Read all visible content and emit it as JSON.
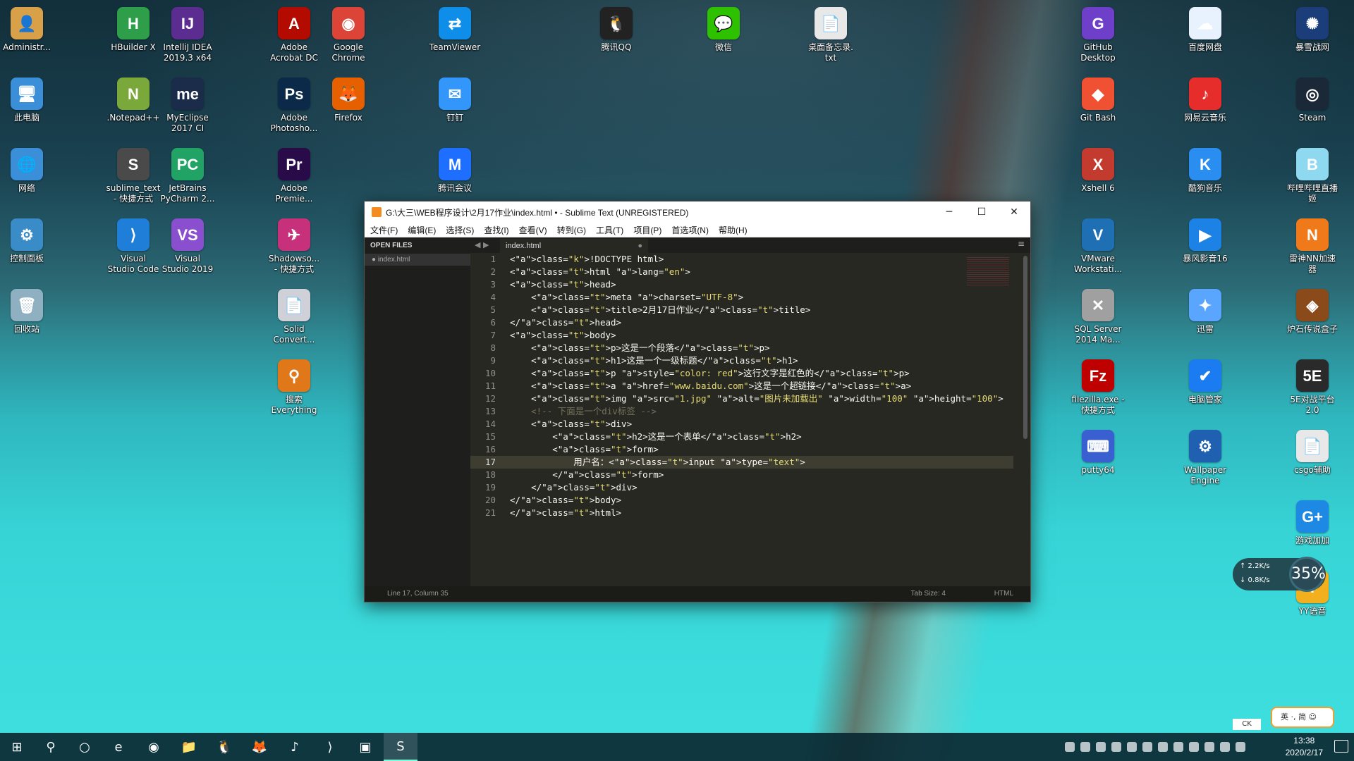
{
  "desktop_icons": [
    {
      "label": "Administr...",
      "icon": "user-folder-icon",
      "color": "#d9a04a",
      "glyph": "👤"
    },
    {
      "label": "此电脑",
      "icon": "computer-icon",
      "color": "#3b8fd8",
      "glyph": "🖥"
    },
    {
      "label": "网络",
      "icon": "network-icon",
      "color": "#3b8fd8",
      "glyph": "🌐"
    },
    {
      "label": "控制面板",
      "icon": "control-panel-icon",
      "color": "#3a8cc8",
      "glyph": "⚙"
    },
    {
      "label": "回收站",
      "icon": "recycle-bin-icon",
      "color": "#8fb0c0",
      "glyph": "🗑"
    },
    {
      "label": "HBuilder X",
      "icon": "hbuilder-icon",
      "color": "#2e9e4b",
      "glyph": "H"
    },
    {
      "label": ".Notepad++",
      "icon": "notepad-plus-plus-icon",
      "color": "#7aa83a",
      "glyph": "N"
    },
    {
      "label": "sublime_text\n- 快捷方式",
      "icon": "sublime-text-icon",
      "color": "#4a4a4a",
      "glyph": "S"
    },
    {
      "label": "Visual\nStudio Code",
      "icon": "vscode-icon",
      "color": "#1f7fd8",
      "glyph": "⟩"
    },
    {
      "label": "IntelliJ IDEA\n2019.3 x64",
      "icon": "intellij-icon",
      "color": "#5c2d91",
      "glyph": "IJ"
    },
    {
      "label": "MyEclipse\n2017 CI",
      "icon": "myeclipse-icon",
      "color": "#1a2c4a",
      "glyph": "me"
    },
    {
      "label": "JetBrains\nPyCharm 2...",
      "icon": "pycharm-icon",
      "color": "#21a366",
      "glyph": "PC"
    },
    {
      "label": "Visual\nStudio 2019",
      "icon": "visual-studio-icon",
      "color": "#8a4fcf",
      "glyph": "VS"
    },
    {
      "label": "Adobe\nAcrobat DC",
      "icon": "acrobat-icon",
      "color": "#b30b00",
      "glyph": "A"
    },
    {
      "label": "Adobe\nPhotosho...",
      "icon": "photoshop-icon",
      "color": "#0b2a4a",
      "glyph": "Ps"
    },
    {
      "label": "Adobe\nPremie...",
      "icon": "premiere-icon",
      "color": "#2a0b4a",
      "glyph": "Pr"
    },
    {
      "label": "Shadowso...\n- 快捷方式",
      "icon": "shadowsocks-icon",
      "color": "#c7307a",
      "glyph": "✈"
    },
    {
      "label": "Solid\nConvert...",
      "icon": "solid-converter-icon",
      "color": "#d0d0d8",
      "glyph": "📄"
    },
    {
      "label": "搜索\nEverything",
      "icon": "everything-search-icon",
      "color": "#e0781a",
      "glyph": "⚲"
    },
    {
      "label": "Google\nChrome",
      "icon": "chrome-icon",
      "color": "#db4437",
      "glyph": "◉"
    },
    {
      "label": "Firefox",
      "icon": "firefox-icon",
      "color": "#e66000",
      "glyph": "🦊"
    },
    {
      "label": "TeamViewer",
      "icon": "teamviewer-icon",
      "color": "#0e8ee9",
      "glyph": "⇄"
    },
    {
      "label": "钉钉",
      "icon": "dingtalk-icon",
      "color": "#3296fa",
      "glyph": "✉"
    },
    {
      "label": "腾讯会议",
      "icon": "tencent-meeting-icon",
      "color": "#1e6fff",
      "glyph": "M"
    },
    {
      "label": "腾讯QQ",
      "icon": "qq-icon",
      "color": "#222222",
      "glyph": "🐧"
    },
    {
      "label": "微信",
      "icon": "wechat-icon",
      "color": "#2dc100",
      "glyph": "💬"
    },
    {
      "label": "桌面备忘录.\ntxt",
      "icon": "text-file-icon",
      "color": "#e8e8e8",
      "glyph": "📄"
    },
    {
      "label": "GitHub\nDesktop",
      "icon": "github-desktop-icon",
      "color": "#6e40c9",
      "glyph": "G"
    },
    {
      "label": "Git Bash",
      "icon": "git-bash-icon",
      "color": "#f05133",
      "glyph": "◆"
    },
    {
      "label": "Xshell 6",
      "icon": "xshell-icon",
      "color": "#c33b2f",
      "glyph": "X"
    },
    {
      "label": "VMware\nWorkstati...",
      "icon": "vmware-icon",
      "color": "#1f6fb4",
      "glyph": "V"
    },
    {
      "label": "SQL Server\n2014 Ma...",
      "icon": "sql-server-icon",
      "color": "#a0a0a0",
      "glyph": "✕"
    },
    {
      "label": "filezilla.exe -\n快捷方式",
      "icon": "filezilla-icon",
      "color": "#bf0000",
      "glyph": "Fz"
    },
    {
      "label": "putty64",
      "icon": "putty-icon",
      "color": "#3a5fd0",
      "glyph": "⌨"
    },
    {
      "label": "百度网盘",
      "icon": "baidu-netdisk-icon",
      "color": "#e8f2ff",
      "glyph": "☁"
    },
    {
      "label": "网易云音乐",
      "icon": "netease-music-icon",
      "color": "#e72d2c",
      "glyph": "♪"
    },
    {
      "label": "酷狗音乐",
      "icon": "kugou-music-icon",
      "color": "#2a8ef0",
      "glyph": "K"
    },
    {
      "label": "暴风影音16",
      "icon": "baofeng-player-icon",
      "color": "#1d82e6",
      "glyph": "▶"
    },
    {
      "label": "迅雷",
      "icon": "xunlei-icon",
      "color": "#5aa6ff",
      "glyph": "✦"
    },
    {
      "label": "电脑管家",
      "icon": "pc-manager-icon",
      "color": "#1a7cf0",
      "glyph": "✔"
    },
    {
      "label": "Wallpaper\nEngine",
      "icon": "wallpaper-engine-icon",
      "color": "#2060b0",
      "glyph": "⚙"
    },
    {
      "label": "暴雪战网",
      "icon": "battlenet-icon",
      "color": "#1b3e7a",
      "glyph": "✺"
    },
    {
      "label": "Steam",
      "icon": "steam-icon",
      "color": "#1b2838",
      "glyph": "◎"
    },
    {
      "label": "哔哩哔哩直播\n姬",
      "icon": "bilibili-live-icon",
      "color": "#8ed8f0",
      "glyph": "B"
    },
    {
      "label": "雷神NN加速\n器",
      "icon": "nn-accelerator-icon",
      "color": "#f07a1a",
      "glyph": "N"
    },
    {
      "label": "炉石传说盒子",
      "icon": "hearthstone-box-icon",
      "color": "#8a4a1a",
      "glyph": "◈"
    },
    {
      "label": "5E对战平台\n2.0",
      "icon": "5e-platform-icon",
      "color": "#2a2a2a",
      "glyph": "5E"
    },
    {
      "label": "csgo辅助",
      "icon": "csgo-helper-icon",
      "color": "#e8e8e8",
      "glyph": "📄"
    },
    {
      "label": "游戏加加",
      "icon": "game-plus-icon",
      "color": "#1e88e5",
      "glyph": "G+"
    },
    {
      "label": "YY语音",
      "icon": "yy-voice-icon",
      "color": "#f2b01e",
      "glyph": "Y"
    }
  ],
  "window": {
    "title": "G:\\大三\\WEB程序设计\\2月17作业\\index.html • - Sublime Text (UNREGISTERED)",
    "minimize": "─",
    "maximize": "☐",
    "close": "✕",
    "menu": [
      "文件(F)",
      "编辑(E)",
      "选择(S)",
      "查找(I)",
      "查看(V)",
      "转到(G)",
      "工具(T)",
      "项目(P)",
      "首选项(N)",
      "帮助(H)"
    ],
    "sidebar_header": "OPEN FILES",
    "sidebar_file": "● index.html",
    "tab_label": "index.html",
    "tab_dot": "●",
    "nav_arrows": "◀ ▶",
    "tab_menu": "≡",
    "current_line": 17,
    "status": {
      "position": "Line 17, Column 35",
      "tab_size": "Tab Size: 4",
      "syntax": "HTML"
    }
  },
  "code_lines": [
    "<!DOCTYPE html>",
    "<html lang=\"en\">",
    "<head>",
    "    <meta charset=\"UTF-8\">",
    "    <title>2月17日作业</title>",
    "</head>",
    "<body>",
    "    <p>这是一个段落</p>",
    "    <h1>这是一个一级标题</h1>",
    "    <p style=\"color: red\">这行文字是红色的</p>",
    "    <a href=\"www.baidu.com\">这是一个超链接</a>",
    "    <img src=\"1.jpg\" alt=\"图片未加载出\" width=\"100\" height=\"100\">",
    "    <!-- 下面是一个div标签 -->",
    "    <div>",
    "        <h2>这是一个表单</h2>",
    "        <form>",
    "            用户名：<input type=\"text\">",
    "        </form>",
    "    </div>",
    "</body>",
    "</html>"
  ],
  "taskbar": {
    "items": [
      {
        "name": "start-button",
        "glyph": "⊞"
      },
      {
        "name": "search-icon",
        "glyph": "⚲"
      },
      {
        "name": "task-view-icon",
        "glyph": "○"
      },
      {
        "name": "edge-icon",
        "glyph": "e"
      },
      {
        "name": "chrome-taskbar-icon",
        "glyph": "◉"
      },
      {
        "name": "file-explorer-icon",
        "glyph": "📁"
      },
      {
        "name": "qq-taskbar-icon",
        "glyph": "🐧"
      },
      {
        "name": "firefox-taskbar-icon",
        "glyph": "🦊"
      },
      {
        "name": "netease-music-taskbar-icon",
        "glyph": "♪"
      },
      {
        "name": "vscode-taskbar-icon",
        "glyph": "⟩"
      },
      {
        "name": "control-panel-taskbar-icon",
        "glyph": "▣"
      },
      {
        "name": "sublime-taskbar-icon",
        "glyph": "S"
      }
    ],
    "clock_time": "13:38",
    "clock_date": "2020/2/17"
  },
  "net_widget": {
    "up": "↑ 2.2K/s",
    "down": "↓ 0.8K/s",
    "percent": "35%"
  },
  "ime": {
    "label": "英 ·, 简 ☺",
    "ck": "CK"
  }
}
